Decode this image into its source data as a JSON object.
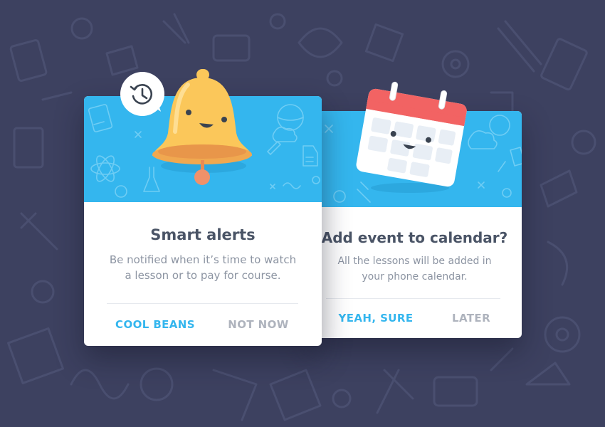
{
  "colors": {
    "background": "#3d4160",
    "banner": "#34b6ee",
    "primary_action": "#34b6ee",
    "secondary_action": "#aeb3bd",
    "title_text": "#4a5466",
    "body_text": "#8c94a2",
    "bell": "#fbc75a",
    "calendar_header": "#f26363"
  },
  "cards": [
    {
      "id": "smart-alerts",
      "illustration": "bell-icon",
      "badge_icon": "clock-history-icon",
      "title": "Smart alerts",
      "description_line1": "Be notified when it’s time to watch",
      "description_line2": "a lesson or to pay for course.",
      "primary_button": "COOL BEANS",
      "secondary_button": "NOT NOW"
    },
    {
      "id": "add-event",
      "illustration": "calendar-icon",
      "title": "Add event to calendar?",
      "description_line1": "All the lessons will be added in",
      "description_line2": "your phone calendar.",
      "primary_button": "YEAH, SURE",
      "secondary_button": "LATER"
    }
  ]
}
